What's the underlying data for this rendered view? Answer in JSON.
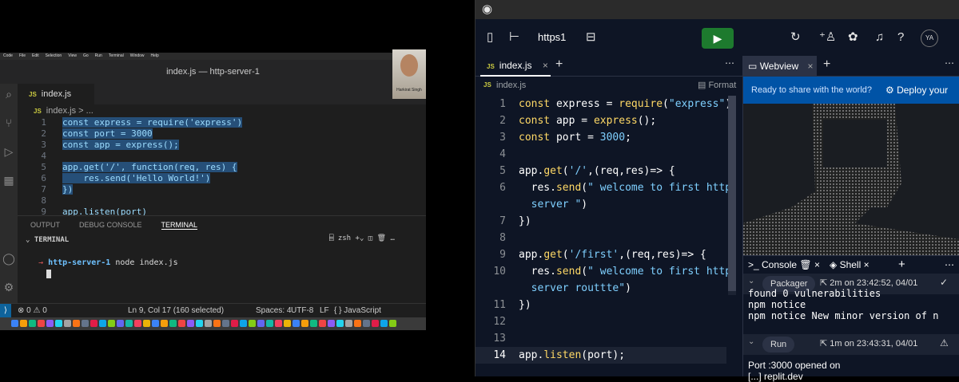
{
  "vscode": {
    "menu": [
      "Code",
      "File",
      "Edit",
      "Selection",
      "View",
      "Go",
      "Run",
      "Terminal",
      "Window",
      "Help"
    ],
    "window_title": "index.js — http-server-1",
    "tab": "index.js",
    "breadcrumb_file": "index.js",
    "breadcrumb_more": "> ...",
    "code": [
      {
        "n": "1",
        "t": "const express = require('express')"
      },
      {
        "n": "2",
        "t": "const port = 3000"
      },
      {
        "n": "3",
        "t": "const app = express();"
      },
      {
        "n": "4",
        "t": ""
      },
      {
        "n": "5",
        "t": "app.get('/', function(req, res) {"
      },
      {
        "n": "6",
        "t": "    res.send('Hello World!')"
      },
      {
        "n": "7",
        "t": "})"
      },
      {
        "n": "8",
        "t": ""
      },
      {
        "n": "9",
        "t": "app.listen(port)"
      }
    ],
    "panel_tabs": [
      "OUTPUT",
      "DEBUG CONSOLE",
      "TERMINAL"
    ],
    "terminal_header": "TERMINAL",
    "terminal_shell": "zsh",
    "terminal_prompt_dir": "http-server-1",
    "terminal_cmd": "node index.js",
    "status": {
      "errors": "0",
      "warnings": "0",
      "position": "Ln 9, Col 17 (160 selected)",
      "spaces": "Spaces: 4",
      "encoding": "UTF-8",
      "eol": "LF",
      "language": "{ } JavaScript"
    },
    "camera_name": "Harkirat Singh"
  },
  "replit": {
    "repl_name": "https1",
    "avatar": "YA",
    "editor_tab": "index.js",
    "breadcrumb": "index.js",
    "format_label": "Format",
    "code_lines": [
      {
        "n": "1",
        "parts": [
          [
            "kw",
            "const "
          ],
          [
            "fn",
            "express = "
          ],
          [
            "kw",
            "require"
          ],
          [
            "fn",
            "("
          ],
          [
            "st",
            "\"express\""
          ],
          [
            "fn",
            ")"
          ]
        ]
      },
      {
        "n": "2",
        "parts": [
          [
            "kw",
            "const "
          ],
          [
            "fn",
            "app = "
          ],
          [
            "kw",
            "express"
          ],
          [
            "fn",
            "();"
          ]
        ]
      },
      {
        "n": "3",
        "parts": [
          [
            "kw",
            "const "
          ],
          [
            "fn",
            "port = "
          ],
          [
            "st",
            "3000"
          ],
          [
            "fn",
            ";"
          ]
        ]
      },
      {
        "n": "4",
        "parts": []
      },
      {
        "n": "5",
        "parts": [
          [
            "fn",
            "app."
          ],
          [
            "kw",
            "get"
          ],
          [
            "fn",
            "("
          ],
          [
            "st",
            "'/'"
          ],
          [
            "fn",
            ",(req,res)=> {"
          ]
        ]
      },
      {
        "n": "6",
        "parts": [
          [
            "fn",
            "  res."
          ],
          [
            "kw",
            "send"
          ],
          [
            "fn",
            "("
          ],
          [
            "st",
            "\" welcome to first http"
          ]
        ]
      },
      {
        "n": "",
        "parts": [
          [
            "st",
            "  server \""
          ],
          [
            "fn",
            ")"
          ]
        ]
      },
      {
        "n": "7",
        "parts": [
          [
            "fn",
            "})"
          ]
        ]
      },
      {
        "n": "8",
        "parts": []
      },
      {
        "n": "9",
        "parts": [
          [
            "fn",
            "app."
          ],
          [
            "kw",
            "get"
          ],
          [
            "fn",
            "("
          ],
          [
            "st",
            "'/first'"
          ],
          [
            "fn",
            ",(req,res)=> {"
          ]
        ]
      },
      {
        "n": "10",
        "parts": [
          [
            "fn",
            "  res."
          ],
          [
            "kw",
            "send"
          ],
          [
            "fn",
            "("
          ],
          [
            "st",
            "\" welcome to first http"
          ]
        ]
      },
      {
        "n": "",
        "parts": [
          [
            "st",
            "  server routtte\""
          ],
          [
            "fn",
            ")"
          ]
        ]
      },
      {
        "n": "11",
        "parts": [
          [
            "fn",
            "})"
          ]
        ]
      },
      {
        "n": "12",
        "parts": []
      },
      {
        "n": "13",
        "parts": []
      },
      {
        "n": "14",
        "parts": [
          [
            "fn",
            "app."
          ],
          [
            "kw",
            "listen"
          ],
          [
            "fn",
            "(port);"
          ]
        ]
      }
    ],
    "webview_tab": "Webview",
    "banner_text": "Ready to share with the world?",
    "deploy_text": "Deploy your",
    "console_tab": "Console",
    "shell_tab": "Shell",
    "packager": {
      "label": "Packager",
      "time": "2m on 23:42:52, 04/01"
    },
    "console_lines": [
      "found 0 vulnerabilities",
      "npm notice",
      "npm notice New minor version of n"
    ],
    "run": {
      "label": "Run",
      "time": "1m on 23:43:31, 04/01"
    },
    "run_output": [
      "Port :3000 opened on",
      "[...] replit.dev"
    ]
  }
}
